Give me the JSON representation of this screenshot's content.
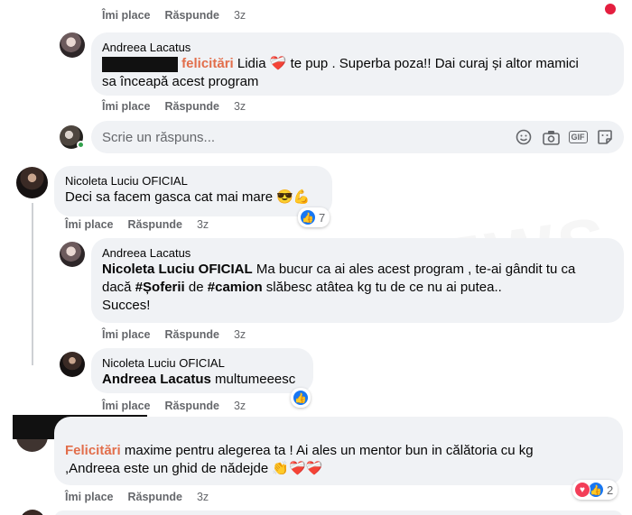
{
  "watermark": "NEWS",
  "comments": [
    {
      "id": "top-partial",
      "actions": {
        "like": "Îmi place",
        "reply": "Răspunde",
        "time": "3z"
      }
    },
    {
      "id": "reply-andreea-1",
      "author": "Andreea Lacatus",
      "text_tag": "felicitări",
      "text_rest": " Lidia ❤️‍🩹 te pup . Superba poza!! Dai curaj și altor mamici",
      "text_line2": "sa înceapă acest program",
      "actions": {
        "like": "Îmi place",
        "reply": "Răspunde",
        "time": "3z"
      }
    },
    {
      "id": "comment-nicoleta",
      "author": "Nicoleta Luciu OFICIAL",
      "text": "Deci sa facem gasca cat mai mare 😎💪",
      "reaction_count": "7",
      "actions": {
        "like": "Îmi place",
        "reply": "Răspunde",
        "time": "3z"
      }
    },
    {
      "id": "reply-andreea-2",
      "author": "Andreea Lacatus",
      "mention": "Nicoleta Luciu OFICIAL",
      "line1_rest": " Ma bucur ca ai ales acest program , te-ai gândit tu ca",
      "line2_pre": "dacă ",
      "hashtag1": "#Șoferii",
      "line2_mid": " de ",
      "hashtag2": "#camion",
      "line2_rest": " slăbesc atâtea kg tu de ce nu ai putea..",
      "line3": "Succes!",
      "actions": {
        "like": "Îmi place",
        "reply": "Răspunde",
        "time": "3z"
      }
    },
    {
      "id": "reply-nicoleta",
      "author": "Nicoleta Luciu OFICIAL",
      "mention": "Andreea Lacatus",
      "text_rest": " multumeeesc",
      "actions": {
        "like": "Îmi place",
        "reply": "Răspunde",
        "time": "3z"
      }
    },
    {
      "id": "comment-redacted",
      "text_tag": "Felicitări",
      "text_rest": " maxime pentru alegerea ta ! Ai ales un mentor bun in călătoria cu kg",
      "text_line2": ",Andreea este un ghid de nădejde 👏❤️‍🩹❤️‍🩹",
      "reaction_count": "2",
      "actions": {
        "like": "Îmi place",
        "reply": "Răspunde",
        "time": "3z"
      }
    }
  ],
  "reply_box": {
    "placeholder": "Scrie un răspuns...",
    "tools": [
      "smiley-icon",
      "camera-icon",
      "gif-icon",
      "sticker-icon"
    ],
    "gif_label": "GIF"
  },
  "colors": {
    "tag": "#e26e4b",
    "like": "#1877f2",
    "love": "#f33e58",
    "online": "#31a24c"
  }
}
